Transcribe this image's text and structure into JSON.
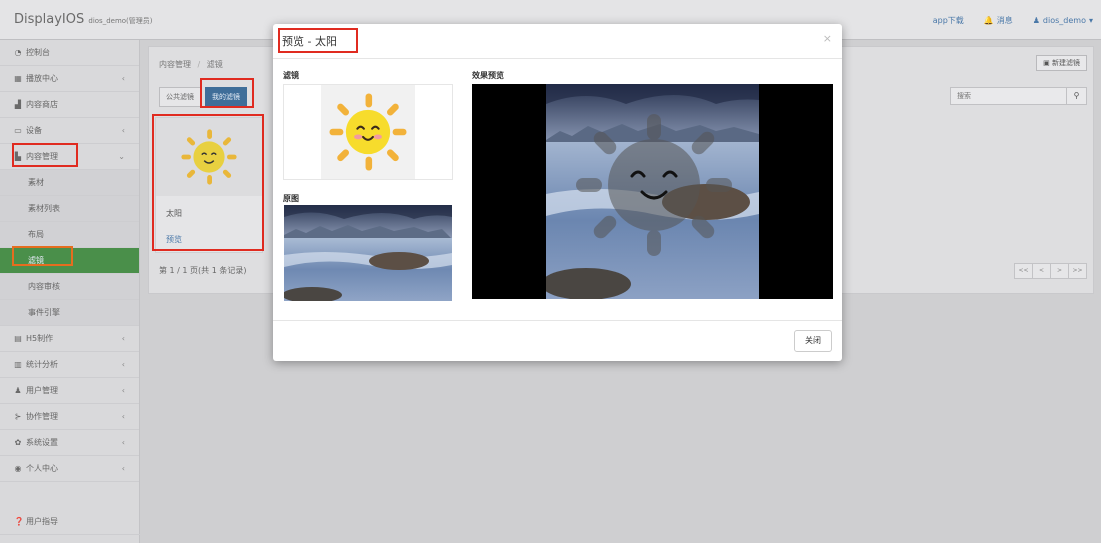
{
  "app": {
    "name": "DisplayIOS",
    "user_note": "dios_demo(管理员)"
  },
  "topbar": {
    "app_download": "app下载",
    "messages": "消息",
    "user": "dios_demo"
  },
  "sidebar": {
    "items": [
      {
        "label": "控制台",
        "icon": "dashboard-icon"
      },
      {
        "label": "播放中心",
        "icon": "grid-icon",
        "chevron": "‹"
      },
      {
        "label": "内容商店",
        "icon": "store-icon"
      },
      {
        "label": "设备",
        "icon": "monitor-icon",
        "chevron": "‹"
      },
      {
        "label": "内容管理",
        "icon": "folder-icon",
        "chevron": "⌄"
      },
      {
        "label": "素材"
      },
      {
        "label": "素材列表"
      },
      {
        "label": "布局"
      },
      {
        "label": "滤镜"
      },
      {
        "label": "内容审核"
      },
      {
        "label": "事件引擎"
      },
      {
        "label": "H5制作",
        "icon": "h5-icon",
        "chevron": "‹"
      },
      {
        "label": "统计分析",
        "icon": "chart-icon",
        "chevron": "‹"
      },
      {
        "label": "用户管理",
        "icon": "users-icon",
        "chevron": "‹"
      },
      {
        "label": "协作管理",
        "icon": "share-icon",
        "chevron": "‹"
      },
      {
        "label": "系统设置",
        "icon": "gear-icon",
        "chevron": "‹"
      },
      {
        "label": "个人中心",
        "icon": "user-icon",
        "chevron": "‹"
      }
    ],
    "bottom": "用户指导"
  },
  "main": {
    "breadcrumb": [
      "内容管理",
      "滤镜"
    ],
    "new_button": "新建滤镜",
    "tabs": [
      "公共滤镜",
      "我的滤镜"
    ],
    "search_placeholder": "搜索",
    "card": {
      "name": "太阳",
      "preview_link": "预览"
    },
    "pager_text": "第 1 / 1 页(共 1 条记录)",
    "pager_buttons": [
      "<<",
      "<",
      ">",
      ">>"
    ]
  },
  "modal": {
    "title": "预览 - 太阳",
    "close_symbol": "×",
    "filter_label": "滤镜",
    "original_label": "原图",
    "effect_label": "效果预览",
    "close_button": "关闭"
  },
  "colors": {
    "accent_blue": "#3f6e99",
    "active_green": "#4a8f4a",
    "highlight_red": "#e02b20",
    "highlight_orange": "#e56d1f"
  }
}
